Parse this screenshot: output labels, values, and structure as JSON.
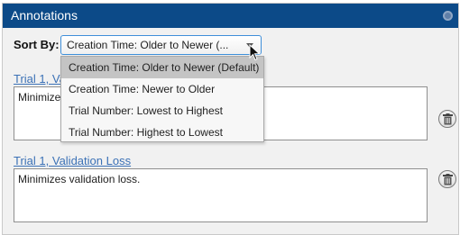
{
  "panel": {
    "title": "Annotations"
  },
  "sort": {
    "label": "Sort By:",
    "selected_display": "Creation Time: Older to Newer (...",
    "options": [
      "Creation Time: Older to Newer (Default)",
      "Creation Time: Newer to Older",
      "Trial Number: Lowest to Highest",
      "Trial Number: Highest to Lowest"
    ]
  },
  "annotations": [
    {
      "title": "Trial 1, Va",
      "note": "Minimizes"
    },
    {
      "title": "Trial 1, Validation Loss",
      "note": "Minimizes validation loss."
    }
  ],
  "colors": {
    "titlebar": "#0c4a88",
    "link": "#3b71b6",
    "dropdown_selected": "#c4c4c4"
  },
  "icons": [
    "gear-icon",
    "dropdown-caret-icon",
    "mouse-cursor-icon",
    "trash-icon"
  ]
}
